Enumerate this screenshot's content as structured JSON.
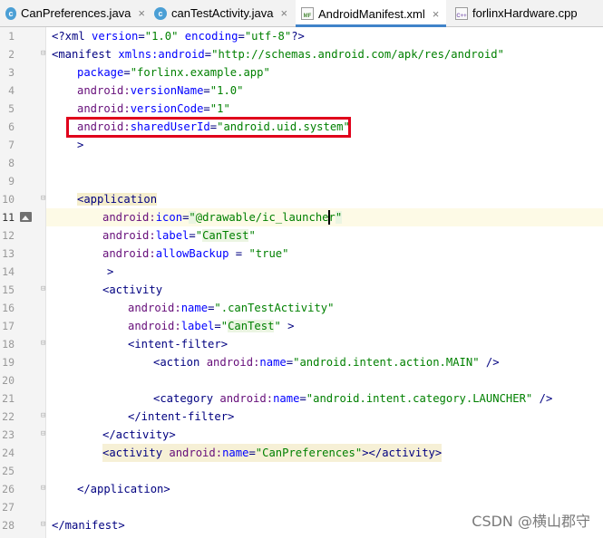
{
  "tabs": [
    {
      "label": "CanPreferences.java",
      "icon": "java-class-icon",
      "active": false
    },
    {
      "label": "canTestActivity.java",
      "icon": "java-class-icon",
      "active": false
    },
    {
      "label": "AndroidManifest.xml",
      "icon": "manifest-file-icon",
      "active": true
    },
    {
      "label": "forlinxHardware.cpp",
      "icon": "cpp-file-icon",
      "active": false
    }
  ],
  "close_glyph": "×",
  "icon_text": {
    "java": "c",
    "xml": "MF",
    "cpp": "C++"
  },
  "line_numbers": [
    "1",
    "2",
    "3",
    "4",
    "5",
    "6",
    "7",
    "8",
    "9",
    "10",
    "11",
    "12",
    "13",
    "14",
    "15",
    "16",
    "17",
    "18",
    "19",
    "20",
    "21",
    "22",
    "23",
    "24",
    "25",
    "26",
    "27",
    "28"
  ],
  "code": {
    "l1": {
      "a": "<?xml ",
      "b": "version",
      "c": "=",
      "d": "\"1.0\"",
      "e": " ",
      "f": "encoding",
      "g": "=",
      "h": "\"utf-8\"",
      "i": "?>"
    },
    "l2": {
      "a": "<manifest ",
      "b": "xmlns:",
      "c": "android",
      "d": "=",
      "e": "\"http://schemas.android.com/apk/res/android\""
    },
    "l3": {
      "a": "package",
      "b": "=",
      "c": "\"forlinx.example.app\""
    },
    "l4": {
      "a": "android:",
      "b": "versionName",
      "c": "=",
      "d": "\"1.0\""
    },
    "l5": {
      "a": "android:",
      "b": "versionCode",
      "c": "=",
      "d": "\"1\""
    },
    "l6": {
      "a": "android:",
      "b": "sharedUserId",
      "c": "=",
      "d": "\"android.uid.system\""
    },
    "l7": {
      "a": ">"
    },
    "l10": {
      "a": "<application"
    },
    "l11": {
      "a": "android:",
      "b": "icon",
      "c": "=",
      "d": "\"",
      "e": "@drawable/ic_launcher",
      "f": "\""
    },
    "l12": {
      "a": "android:",
      "b": "label",
      "c": "=",
      "d": "\"",
      "e": "CanTest",
      "f": "\""
    },
    "l13": {
      "a": "android:",
      "b": "allowBackup",
      "c": " = ",
      "d": "\"true\""
    },
    "l14": {
      "a": ">"
    },
    "l15": {
      "a": "<activity"
    },
    "l16": {
      "a": "android:",
      "b": "name",
      "c": "=",
      "d": "\".canTestActivity\""
    },
    "l17": {
      "a": "android:",
      "b": "label",
      "c": "=",
      "d": "\"",
      "e": "CanTest",
      "f": "\"",
      "g": " >"
    },
    "l18": {
      "a": "<intent-filter>"
    },
    "l19": {
      "a": "<action ",
      "b": "android:",
      "c": "name",
      "d": "=",
      "e": "\"android.intent.action.MAIN\"",
      "f": " />"
    },
    "l21": {
      "a": "<category ",
      "b": "android:",
      "c": "name",
      "d": "=",
      "e": "\"android.intent.category.LAUNCHER\"",
      "f": " />"
    },
    "l22": {
      "a": "</intent-filter>"
    },
    "l23": {
      "a": "</activity>"
    },
    "l24": {
      "a": "<activity ",
      "b": "android:",
      "c": "name",
      "d": "=",
      "e": "\"CanPreferences\"",
      "f": "></activity>"
    },
    "l26": {
      "a": "</application>"
    },
    "l28": {
      "a": "</manifest>"
    }
  },
  "watermark": "CSDN @横山郡守",
  "colors": {
    "tag": "#000080",
    "namespace": "#660e7a",
    "attribute": "#0000ff",
    "value": "#008000",
    "highlight_box": "#e0001b",
    "caret_row": "#fdfae6",
    "active_tab_underline": "#4083c9"
  }
}
